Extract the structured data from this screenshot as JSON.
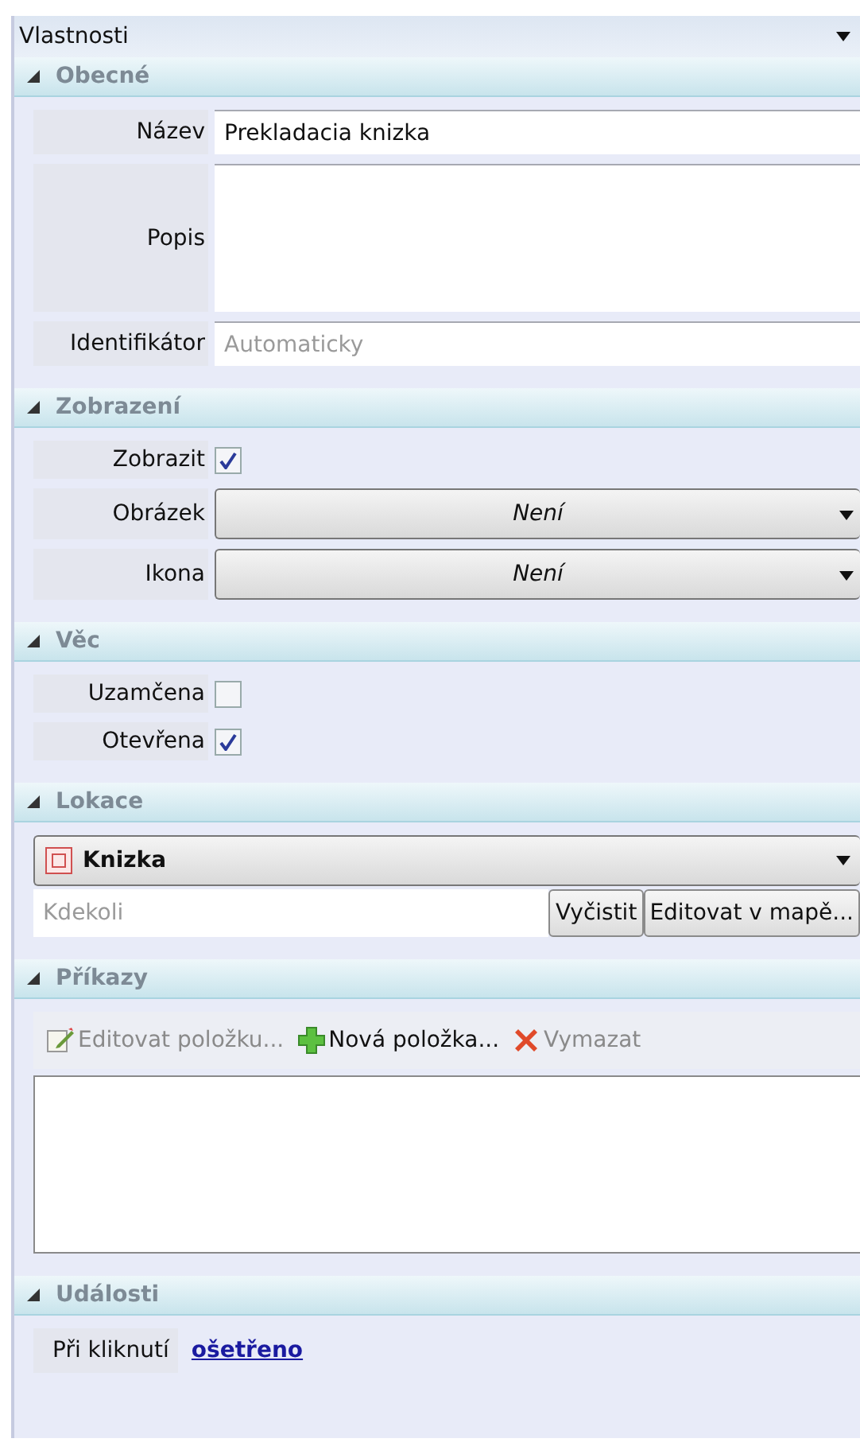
{
  "panel": {
    "title": "Vlastnosti"
  },
  "sections": [
    {
      "kind": "properties",
      "title": "Obecné",
      "expanded": true,
      "rows": [
        {
          "kind": "text",
          "label": "Název",
          "value": "Prekladacia knizka"
        },
        {
          "kind": "multiline",
          "label": "Popis"
        },
        {
          "kind": "text",
          "label": "Identifikátor",
          "placeholder": "Automaticky"
        }
      ]
    },
    {
      "kind": "properties",
      "title": "Zobrazení",
      "expanded": true,
      "rows": [
        {
          "kind": "checkbox",
          "label": "Zobrazit",
          "checked": true
        },
        {
          "kind": "dropdown",
          "label": "Obrázek",
          "value": "Není"
        },
        {
          "kind": "dropdown",
          "label": "Ikona",
          "value": "Není"
        }
      ]
    },
    {
      "kind": "properties",
      "title": "Věc",
      "expanded": true,
      "rows": [
        {
          "kind": "checkbox",
          "label": "Uzamčena",
          "checked": false
        },
        {
          "kind": "checkbox",
          "label": "Otevřena",
          "checked": true
        }
      ]
    },
    {
      "kind": "location",
      "title": "Lokace",
      "expanded": true,
      "location": "Knizka",
      "field": {
        "placeholder": "Kdekoli"
      },
      "buttons": [
        "Vyčistit",
        "Editovat v mapě..."
      ]
    },
    {
      "kind": "commands",
      "title": "Příkazy",
      "expanded": true,
      "toolbar": [
        {
          "kind": "edit",
          "label": "Editovat položku...",
          "disabled": true
        },
        {
          "kind": "add",
          "label": "Nová položka...",
          "disabled": false
        },
        {
          "kind": "delete",
          "label": "Vymazat",
          "disabled": true
        }
      ]
    },
    {
      "kind": "events",
      "title": "Události",
      "expanded": true,
      "rows": [
        {
          "label": "Při kliknutí",
          "link": "ošetřeno"
        }
      ]
    }
  ]
}
